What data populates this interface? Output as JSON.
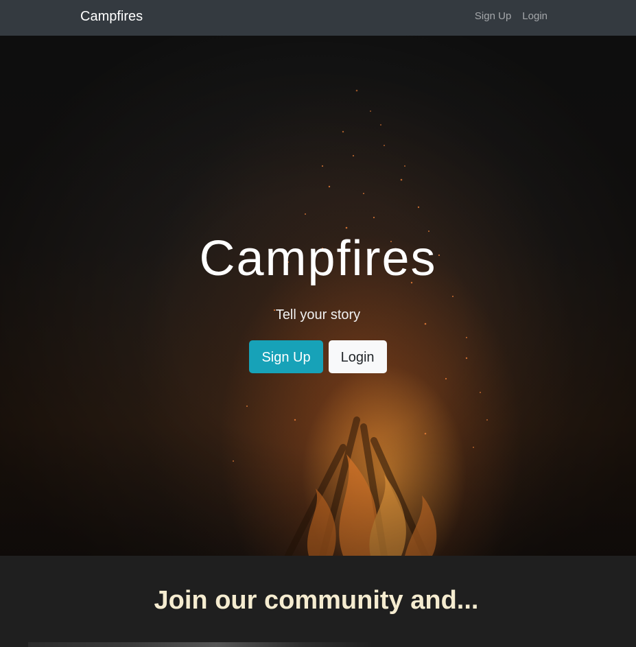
{
  "navbar": {
    "brand": "Campfires",
    "links": [
      {
        "label": "Sign Up"
      },
      {
        "label": "Login"
      }
    ]
  },
  "hero": {
    "title": "Campfires",
    "subtitle": "Tell your story",
    "signup_label": "Sign Up",
    "login_label": "Login"
  },
  "community": {
    "heading": "Join our community and..."
  },
  "colors": {
    "navbar_bg": "#343a40",
    "primary": "#17a2b8",
    "light": "#f8f9fa",
    "heading_cream": "#f5ecd0"
  }
}
